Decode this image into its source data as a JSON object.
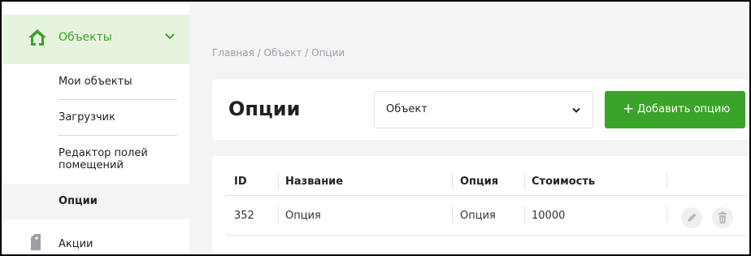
{
  "sidebar": {
    "section_label": "Объекты",
    "section_icon": "house-icon",
    "items": [
      {
        "label": "Мои объекты"
      },
      {
        "label": "Загрузчик"
      },
      {
        "label": "Редактор полей помещений"
      },
      {
        "label": "Опции"
      }
    ],
    "promo_label": "Акции",
    "accent_color": "#3aa329"
  },
  "breadcrumb": "Главная / Объект / Опции",
  "header": {
    "title": "Опции",
    "object_select": "Объект",
    "add_button": "Добавить опцию"
  },
  "table": {
    "columns": [
      "ID",
      "Название",
      "Опция",
      "Стоимость"
    ],
    "rows": [
      {
        "id": "352",
        "name": "Опция",
        "option": "Опция",
        "price": "10000"
      }
    ]
  }
}
